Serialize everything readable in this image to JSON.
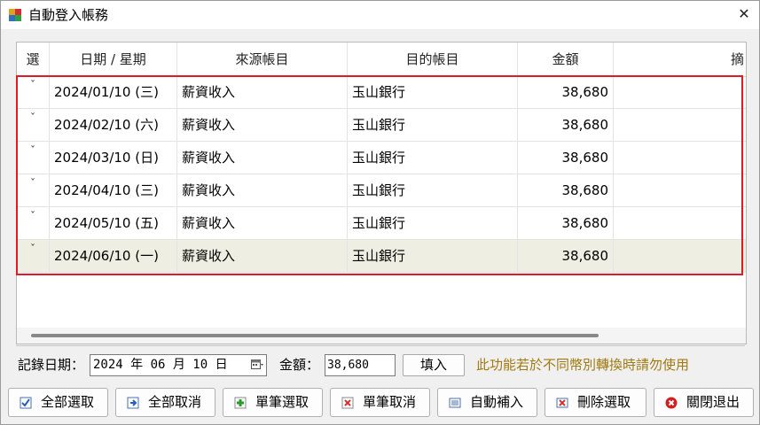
{
  "window": {
    "title": "自動登入帳務",
    "close_glyph": "✕"
  },
  "grid": {
    "columns": [
      "選",
      "日期 / 星期",
      "來源帳目",
      "目的帳目",
      "金額",
      "摘"
    ],
    "rows": [
      {
        "sel": "ˇ",
        "date": "2024/01/10 (三)",
        "source": "薪資收入",
        "target": "玉山銀行",
        "amount": "38,680"
      },
      {
        "sel": "ˇ",
        "date": "2024/02/10 (六)",
        "source": "薪資收入",
        "target": "玉山銀行",
        "amount": "38,680"
      },
      {
        "sel": "ˇ",
        "date": "2024/03/10 (日)",
        "source": "薪資收入",
        "target": "玉山銀行",
        "amount": "38,680"
      },
      {
        "sel": "ˇ",
        "date": "2024/04/10 (三)",
        "source": "薪資收入",
        "target": "玉山銀行",
        "amount": "38,680"
      },
      {
        "sel": "ˇ",
        "date": "2024/05/10 (五)",
        "source": "薪資收入",
        "target": "玉山銀行",
        "amount": "38,680"
      },
      {
        "sel": "ˇ",
        "date": "2024/06/10 (一)",
        "source": "薪資收入",
        "target": "玉山銀行",
        "amount": "38,680"
      }
    ]
  },
  "form": {
    "date_label": "記錄日期：",
    "date_value": "2024 年 06 月 10 日",
    "amount_label": "金額：",
    "amount_value": "38,680",
    "fill_button": "填入",
    "warning": "此功能若於不同幣別轉換時請勿使用"
  },
  "buttons": [
    {
      "label": "全部選取",
      "icon": "select-all-icon"
    },
    {
      "label": "全部取消",
      "icon": "deselect-all-icon"
    },
    {
      "label": "單筆選取",
      "icon": "select-one-icon"
    },
    {
      "label": "單筆取消",
      "icon": "deselect-one-icon"
    },
    {
      "label": "自動補入",
      "icon": "auto-fill-icon"
    },
    {
      "label": "刪除選取",
      "icon": "delete-icon"
    },
    {
      "label": "關閉退出",
      "icon": "exit-icon"
    }
  ],
  "colors": {
    "highlight_border": "#e01b24",
    "selected_row": "#eeeee2",
    "warning_text": "#a07a10"
  }
}
